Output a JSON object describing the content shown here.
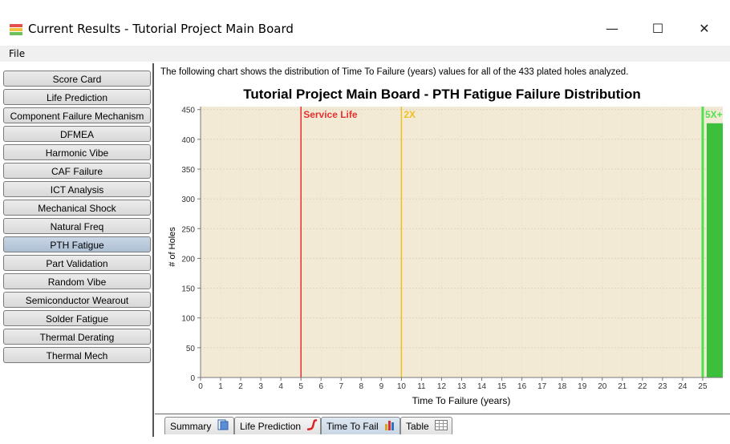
{
  "window": {
    "title": "Current Results - Tutorial Project Main Board",
    "minimize_glyph": "—",
    "maximize_glyph": "☐",
    "close_glyph": "✕"
  },
  "menu": {
    "file": "File"
  },
  "sidebar": {
    "items": [
      {
        "label": "Score Card"
      },
      {
        "label": "Life Prediction"
      },
      {
        "label": "Component Failure Mechanism"
      },
      {
        "label": "DFMEA"
      },
      {
        "label": "Harmonic Vibe"
      },
      {
        "label": "CAF Failure"
      },
      {
        "label": "ICT Analysis"
      },
      {
        "label": "Mechanical Shock"
      },
      {
        "label": "Natural Freq"
      },
      {
        "label": "PTH Fatigue",
        "selected": true
      },
      {
        "label": "Part Validation"
      },
      {
        "label": "Random Vibe"
      },
      {
        "label": "Semiconductor Wearout"
      },
      {
        "label": "Solder Fatigue"
      },
      {
        "label": "Thermal Derating"
      },
      {
        "label": "Thermal Mech"
      }
    ]
  },
  "main": {
    "description": "The following chart shows the distribution of Time To Failure (years) values for all of the 433 plated holes analyzed."
  },
  "tabs": [
    {
      "label": "Summary",
      "icon": "summary-icon"
    },
    {
      "label": "Life Prediction",
      "icon": "life-curve-icon"
    },
    {
      "label": "Time To Fail",
      "icon": "bar-chart-icon",
      "selected": true
    },
    {
      "label": "Table",
      "icon": "table-icon"
    }
  ],
  "chart_data": {
    "type": "bar",
    "title": "Tutorial Project Main Board - PTH Fatigue Failure Distribution",
    "xlabel": "Time To Failure (years)",
    "ylabel": "# of Holes",
    "xlim": [
      0,
      26
    ],
    "ylim": [
      0,
      455
    ],
    "x_ticks": [
      0,
      1,
      2,
      3,
      4,
      5,
      6,
      7,
      8,
      9,
      10,
      11,
      12,
      13,
      14,
      15,
      16,
      17,
      18,
      19,
      20,
      21,
      22,
      23,
      24,
      25
    ],
    "y_ticks": [
      0,
      50,
      100,
      150,
      200,
      250,
      300,
      350,
      400,
      450
    ],
    "bars": [
      {
        "x_start": 25.2,
        "x_end": 26,
        "value": 427,
        "color": "#3cc03c"
      }
    ],
    "markers": [
      {
        "x": 5,
        "label": "Service Life",
        "color": "#e53030"
      },
      {
        "x": 10,
        "label": "2X",
        "color": "#f0c020"
      },
      {
        "x": 25,
        "label": "5X+",
        "color": "#50e050"
      }
    ],
    "plot_background": "#f3ead6",
    "grid": true
  }
}
